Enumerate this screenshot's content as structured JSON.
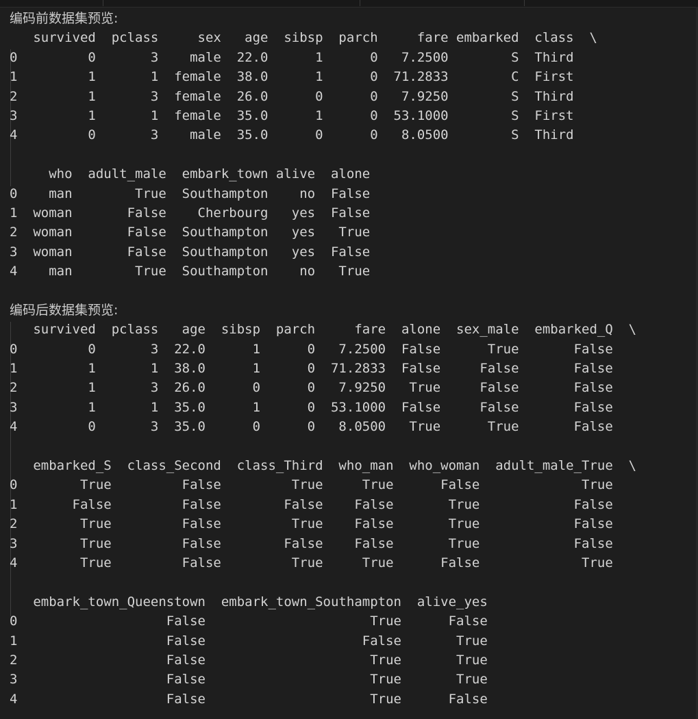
{
  "sections": [
    {
      "heading": "编码前数据集预览:",
      "blocks": [
        {
          "lines": [
            "   survived  pclass     sex   age  sibsp  parch     fare embarked  class  \\",
            "0         0       3    male  22.0      1      0   7.2500        S  Third",
            "1         1       1  female  38.0      1      0  71.2833        C  First",
            "2         1       3  female  26.0      0      0   7.9250        S  Third",
            "3         1       1  female  35.0      1      0  53.1000        S  First",
            "4         0       3    male  35.0      0      0   8.0500        S  Third"
          ]
        },
        {
          "lines": [
            "     who  adult_male  embark_town alive  alone",
            "0    man        True  Southampton    no  False",
            "1  woman       False    Cherbourg   yes  False",
            "2  woman       False  Southampton   yes   True",
            "3  woman       False  Southampton   yes  False",
            "4    man        True  Southampton    no   True"
          ]
        }
      ]
    },
    {
      "heading": "编码后数据集预览:",
      "blocks": [
        {
          "lines": [
            "   survived  pclass   age  sibsp  parch     fare  alone  sex_male  embarked_Q  \\",
            "0         0       3  22.0      1      0   7.2500  False      True       False",
            "1         1       1  38.0      1      0  71.2833  False     False       False",
            "2         1       3  26.0      0      0   7.9250   True     False       False",
            "3         1       1  35.0      1      0  53.1000  False     False       False",
            "4         0       3  35.0      0      0   8.0500   True      True       False"
          ]
        },
        {
          "lines": [
            "   embarked_S  class_Second  class_Third  who_man  who_woman  adult_male_True  \\",
            "0        True         False         True     True      False             True",
            "1       False         False        False    False       True            False",
            "2        True         False         True    False       True            False",
            "3        True         False        False    False       True            False",
            "4        True         False         True     True      False             True"
          ]
        },
        {
          "lines": [
            "   embark_town_Queenstown  embark_town_Southampton  alive_yes",
            "0                   False                     True      False",
            "1                   False                    False       True",
            "2                   False                     True       True",
            "3                   False                     True       True",
            "4                   False                     True      False"
          ]
        }
      ]
    }
  ]
}
